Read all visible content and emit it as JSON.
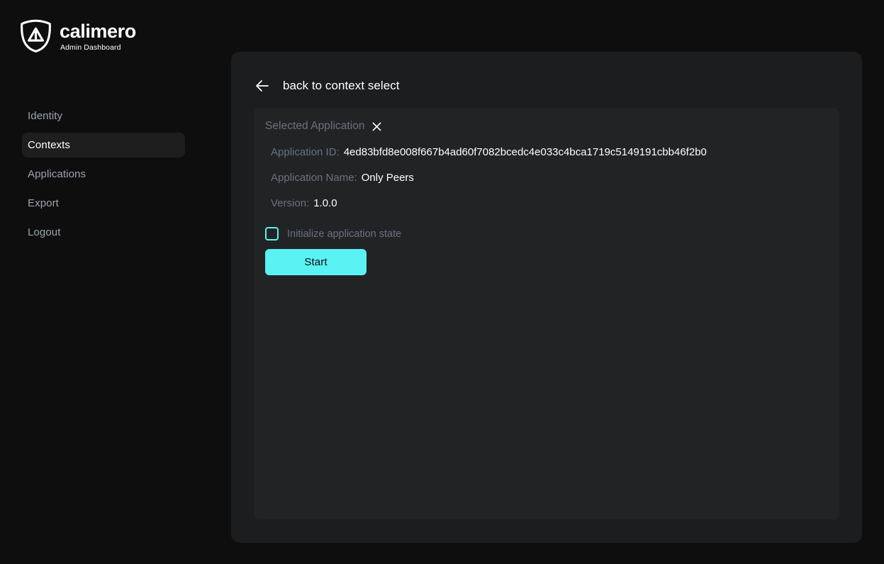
{
  "brand": {
    "name": "calimero",
    "subtitle": "Admin Dashboard",
    "logo_icon": "shield-logo-icon",
    "accent_color": "#5af2f2"
  },
  "sidebar": {
    "items": [
      {
        "label": "Identity",
        "active": false
      },
      {
        "label": "Contexts",
        "active": true
      },
      {
        "label": "Applications",
        "active": false
      },
      {
        "label": "Export",
        "active": false
      },
      {
        "label": "Logout",
        "active": false
      }
    ]
  },
  "panel": {
    "back_icon": "arrow-left-icon",
    "back_label": "back to context select"
  },
  "card": {
    "title": "Selected Application",
    "close_icon": "close-icon",
    "details": [
      {
        "label": "Application ID:",
        "value": "4ed83bfd8e008f667b4ad60f7082bcedc4e033c4bca1719c5149191cbb46f2b0"
      },
      {
        "label": "Application Name:",
        "value": "Only Peers"
      },
      {
        "label": "Version:",
        "value": "1.0.0"
      }
    ],
    "checkbox": {
      "label": "Initialize application state",
      "checked": false,
      "color": "#5af2f2"
    },
    "start_button": {
      "label": "Start",
      "background": "#5af2f2",
      "text_color": "#0b0b0b"
    }
  },
  "colors": {
    "page_background": "#0e0e0e",
    "outer_panel": "#1c1d1f",
    "inner_card": "#212325",
    "muted_text": "#6b7280",
    "nav_active_background": "#1e1e1e"
  }
}
